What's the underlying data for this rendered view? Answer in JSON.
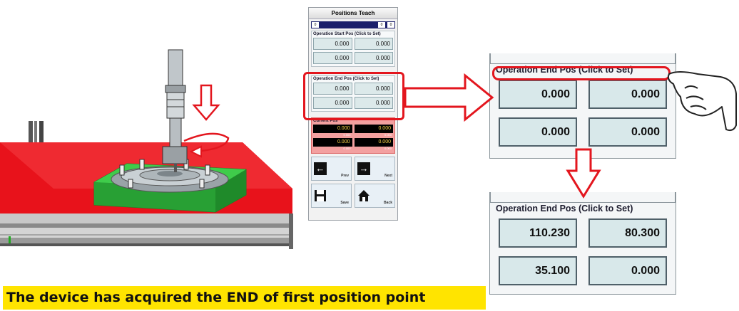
{
  "small_panel": {
    "title": "Positions Teach",
    "status_cells": [
      "0",
      "0",
      "0"
    ],
    "start_section": {
      "label": "Operation Start Pos (Click to Set)",
      "values": [
        "0.000",
        "0.000",
        "0.000",
        "0.000"
      ]
    },
    "end_section": {
      "label": "Operation End Pos (Click to Set)",
      "values": [
        "0.000",
        "0.000",
        "0.000",
        "0.000"
      ]
    },
    "current_section": {
      "label": "Current Pos",
      "values": [
        "0.000",
        "0.000",
        "0.000",
        "0.000"
      ],
      "sub_values": [
        "0.000",
        "0.000",
        "0.000",
        "0.000"
      ]
    },
    "buttons": {
      "prev": "Prev",
      "next": "Next",
      "save": "Save",
      "back": "Back"
    }
  },
  "big_panel_before": {
    "label": "Operation End Pos (Click to Set)",
    "values": [
      "0.000",
      "0.000",
      "0.000",
      "0.000"
    ]
  },
  "big_panel_after": {
    "label": "Operation End Pos (Click to Set)",
    "values": [
      "110.230",
      "80.300",
      "35.100",
      "0.000"
    ]
  },
  "caption": "The device has acquired the END of first position point",
  "colors": {
    "highlight": "#e3161e",
    "arrow": "#e3161e",
    "field": "#d8e8ea",
    "caption_bg": "#ffe400",
    "table_top": "#e8121b",
    "fixture": "#2fb43c"
  },
  "icons": [
    "prev-arrow-icon",
    "next-arrow-icon",
    "save-disk-icon",
    "home-icon",
    "hand-pointer-icon"
  ]
}
